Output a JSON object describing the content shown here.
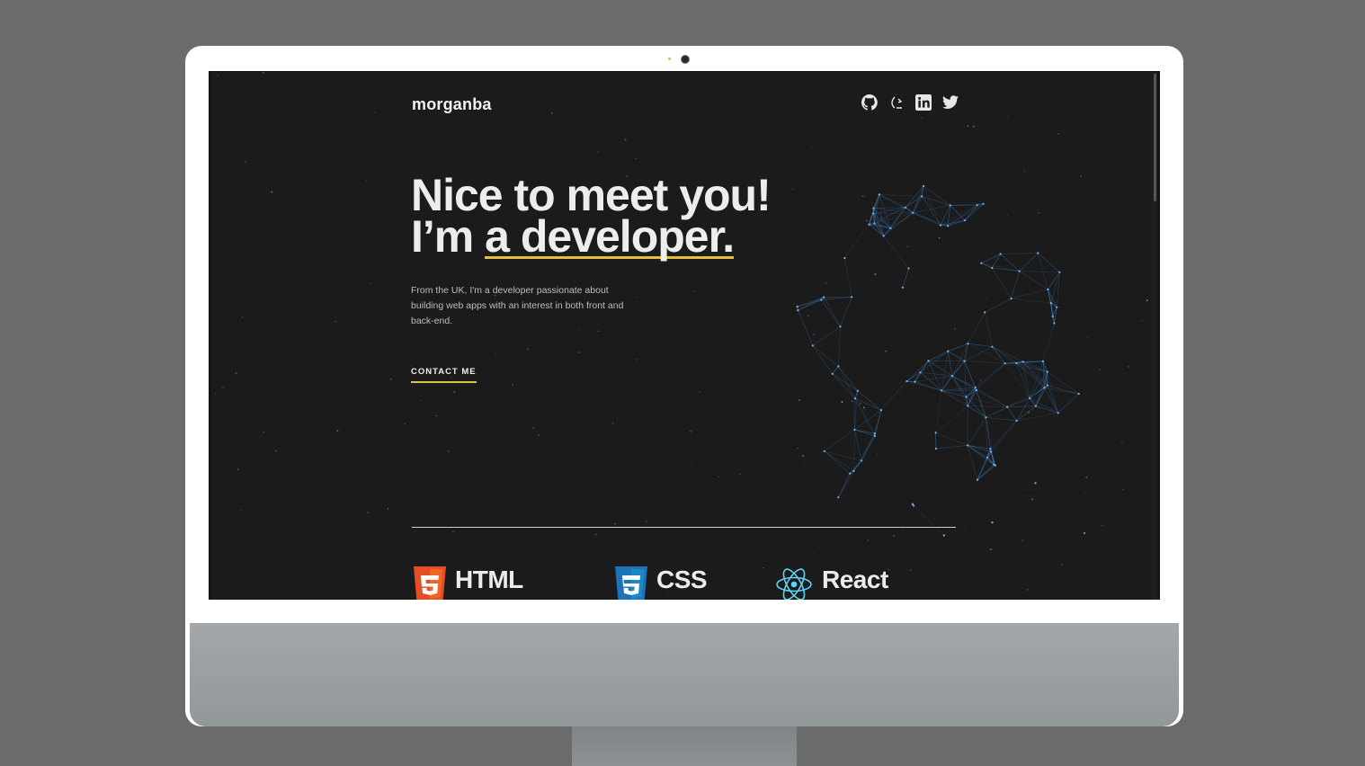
{
  "site": {
    "logo": "morganba",
    "social_icons": [
      "github-icon",
      "dev-icon",
      "linkedin-icon",
      "twitter-icon"
    ]
  },
  "hero": {
    "title_line1": "Nice to meet you!",
    "title_line2_prefix": "I’m ",
    "title_line2_highlight": "a developer.",
    "description": "From the UK, I'm a developer passionate about building web apps with an interest in both front and back-end.",
    "contact_label": "CONTACT ME"
  },
  "skills": [
    {
      "name": "HTML",
      "icon": "html5-icon"
    },
    {
      "name": "CSS",
      "icon": "css3-icon"
    },
    {
      "name": "React",
      "icon": "react-icon"
    }
  ],
  "colors": {
    "background": "#1b1b1b",
    "accent": "#e2c13a",
    "network": "#3a7fc2",
    "text": "#ededed"
  }
}
